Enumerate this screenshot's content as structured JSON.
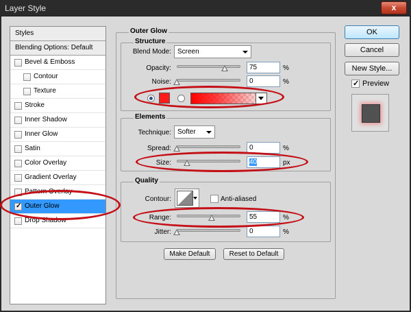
{
  "window": {
    "title": "Layer Style",
    "close_label": "x"
  },
  "styles_list": {
    "header": "Styles",
    "blending_options": "Blending Options: Default",
    "items": [
      {
        "label": "Bevel & Emboss",
        "checked": false,
        "indent": false
      },
      {
        "label": "Contour",
        "checked": false,
        "indent": true
      },
      {
        "label": "Texture",
        "checked": false,
        "indent": true
      },
      {
        "label": "Stroke",
        "checked": false,
        "indent": false
      },
      {
        "label": "Inner Shadow",
        "checked": false,
        "indent": false
      },
      {
        "label": "Inner Glow",
        "checked": false,
        "indent": false
      },
      {
        "label": "Satin",
        "checked": false,
        "indent": false
      },
      {
        "label": "Color Overlay",
        "checked": false,
        "indent": false
      },
      {
        "label": "Gradient Overlay",
        "checked": false,
        "indent": false
      },
      {
        "label": "Pattern Overlay",
        "checked": false,
        "indent": false
      },
      {
        "label": "Outer Glow",
        "checked": true,
        "indent": false,
        "selected": true
      },
      {
        "label": "Drop Shadow",
        "checked": false,
        "indent": false
      }
    ]
  },
  "outer_glow": {
    "title": "Outer Glow",
    "structure": {
      "title": "Structure",
      "blend_mode_label": "Blend Mode:",
      "blend_mode_value": "Screen",
      "opacity_label": "Opacity:",
      "opacity_value": "75",
      "opacity_unit": "%",
      "opacity_level": 0.75,
      "noise_label": "Noise:",
      "noise_value": "0",
      "noise_unit": "%",
      "noise_level": 0,
      "glow_color": "#ff1b1b"
    },
    "elements": {
      "title": "Elements",
      "technique_label": "Technique:",
      "technique_value": "Softer",
      "spread_label": "Spread:",
      "spread_value": "0",
      "spread_unit": "%",
      "spread_level": 0,
      "size_label": "Size:",
      "size_value": "40",
      "size_unit": "px",
      "size_level": 0.16
    },
    "quality": {
      "title": "Quality",
      "contour_label": "Contour:",
      "anti_aliased_label": "Anti-aliased",
      "anti_aliased_checked": false,
      "range_label": "Range:",
      "range_value": "55",
      "range_unit": "%",
      "range_level": 0.55,
      "jitter_label": "Jitter:",
      "jitter_value": "0",
      "jitter_unit": "%",
      "jitter_level": 0
    },
    "make_default_label": "Make Default",
    "reset_default_label": "Reset to Default"
  },
  "actions": {
    "ok_label": "OK",
    "cancel_label": "Cancel",
    "new_style_label": "New Style...",
    "preview_label": "Preview",
    "preview_checked": true
  },
  "colors": {
    "accent_selection": "#3399ff",
    "annotation": "#c40f17",
    "glow": "#ff1b1b"
  }
}
